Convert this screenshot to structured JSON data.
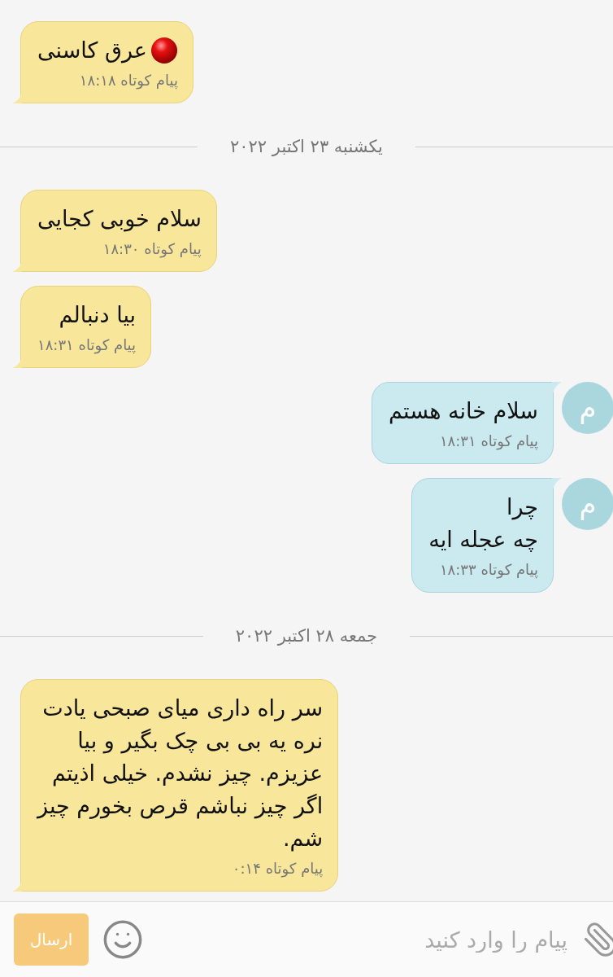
{
  "messages": [
    {
      "kind": "message",
      "sent": false,
      "text": "عرق کاسنی",
      "dot": true,
      "meta": "پیام کوتاه ۱۸:۱۸"
    },
    {
      "kind": "date",
      "text": "یکشنبه ۲۳ اکتبر ۲۰۲۲"
    },
    {
      "kind": "message",
      "sent": false,
      "text": "سلام خوبی کجایی",
      "meta": "پیام کوتاه ۱۸:۳۰"
    },
    {
      "kind": "message",
      "sent": false,
      "text": "بیا دنبالم",
      "meta": "پیام کوتاه ۱۸:۳۱"
    },
    {
      "kind": "message",
      "sent": true,
      "avatar": "م",
      "text": "سلام خانه هستم",
      "meta": "پیام کوتاه ۱۸:۳۱"
    },
    {
      "kind": "message",
      "sent": true,
      "avatar": "م",
      "text": "چرا\nچه عجله ایه",
      "meta": "پیام کوتاه ۱۸:۳۳"
    },
    {
      "kind": "date",
      "text": "جمعه ۲۸ اکتبر ۲۰۲۲"
    },
    {
      "kind": "message",
      "sent": false,
      "text": "سر راه داری میای صبحی یادت\nنره یه بی بی چک بگیر و بیا\nعزیزم. چیز نشدم. خیلی اذیتم\nاگر چیز نباشم قرص بخورم چیز\nشم.",
      "meta": "پیام کوتاه ۰:۱۴"
    }
  ],
  "composer": {
    "placeholder": "پیام را وارد کنید",
    "send": "ارسال"
  }
}
